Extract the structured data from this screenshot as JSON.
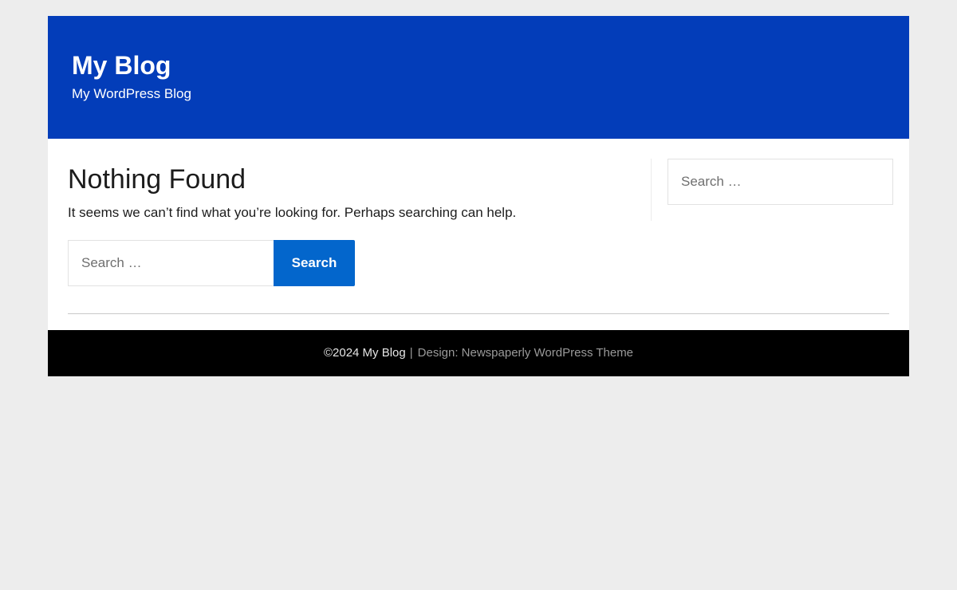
{
  "header": {
    "site_title": "My Blog",
    "tagline": "My WordPress Blog"
  },
  "main": {
    "title": "Nothing Found",
    "message": "It seems we can’t find what you’re looking for. Perhaps searching can help.",
    "search": {
      "placeholder": "Search …",
      "button_label": "Search"
    }
  },
  "sidebar": {
    "search": {
      "placeholder": "Search …"
    }
  },
  "footer": {
    "copyright": "©2024 My Blog",
    "separator": "|",
    "credit": "Design: Newspaperly WordPress Theme"
  },
  "colors": {
    "header_bg": "#033db9",
    "button_bg": "#0366cc",
    "footer_bg": "#000000",
    "page_bg": "#ededed"
  }
}
